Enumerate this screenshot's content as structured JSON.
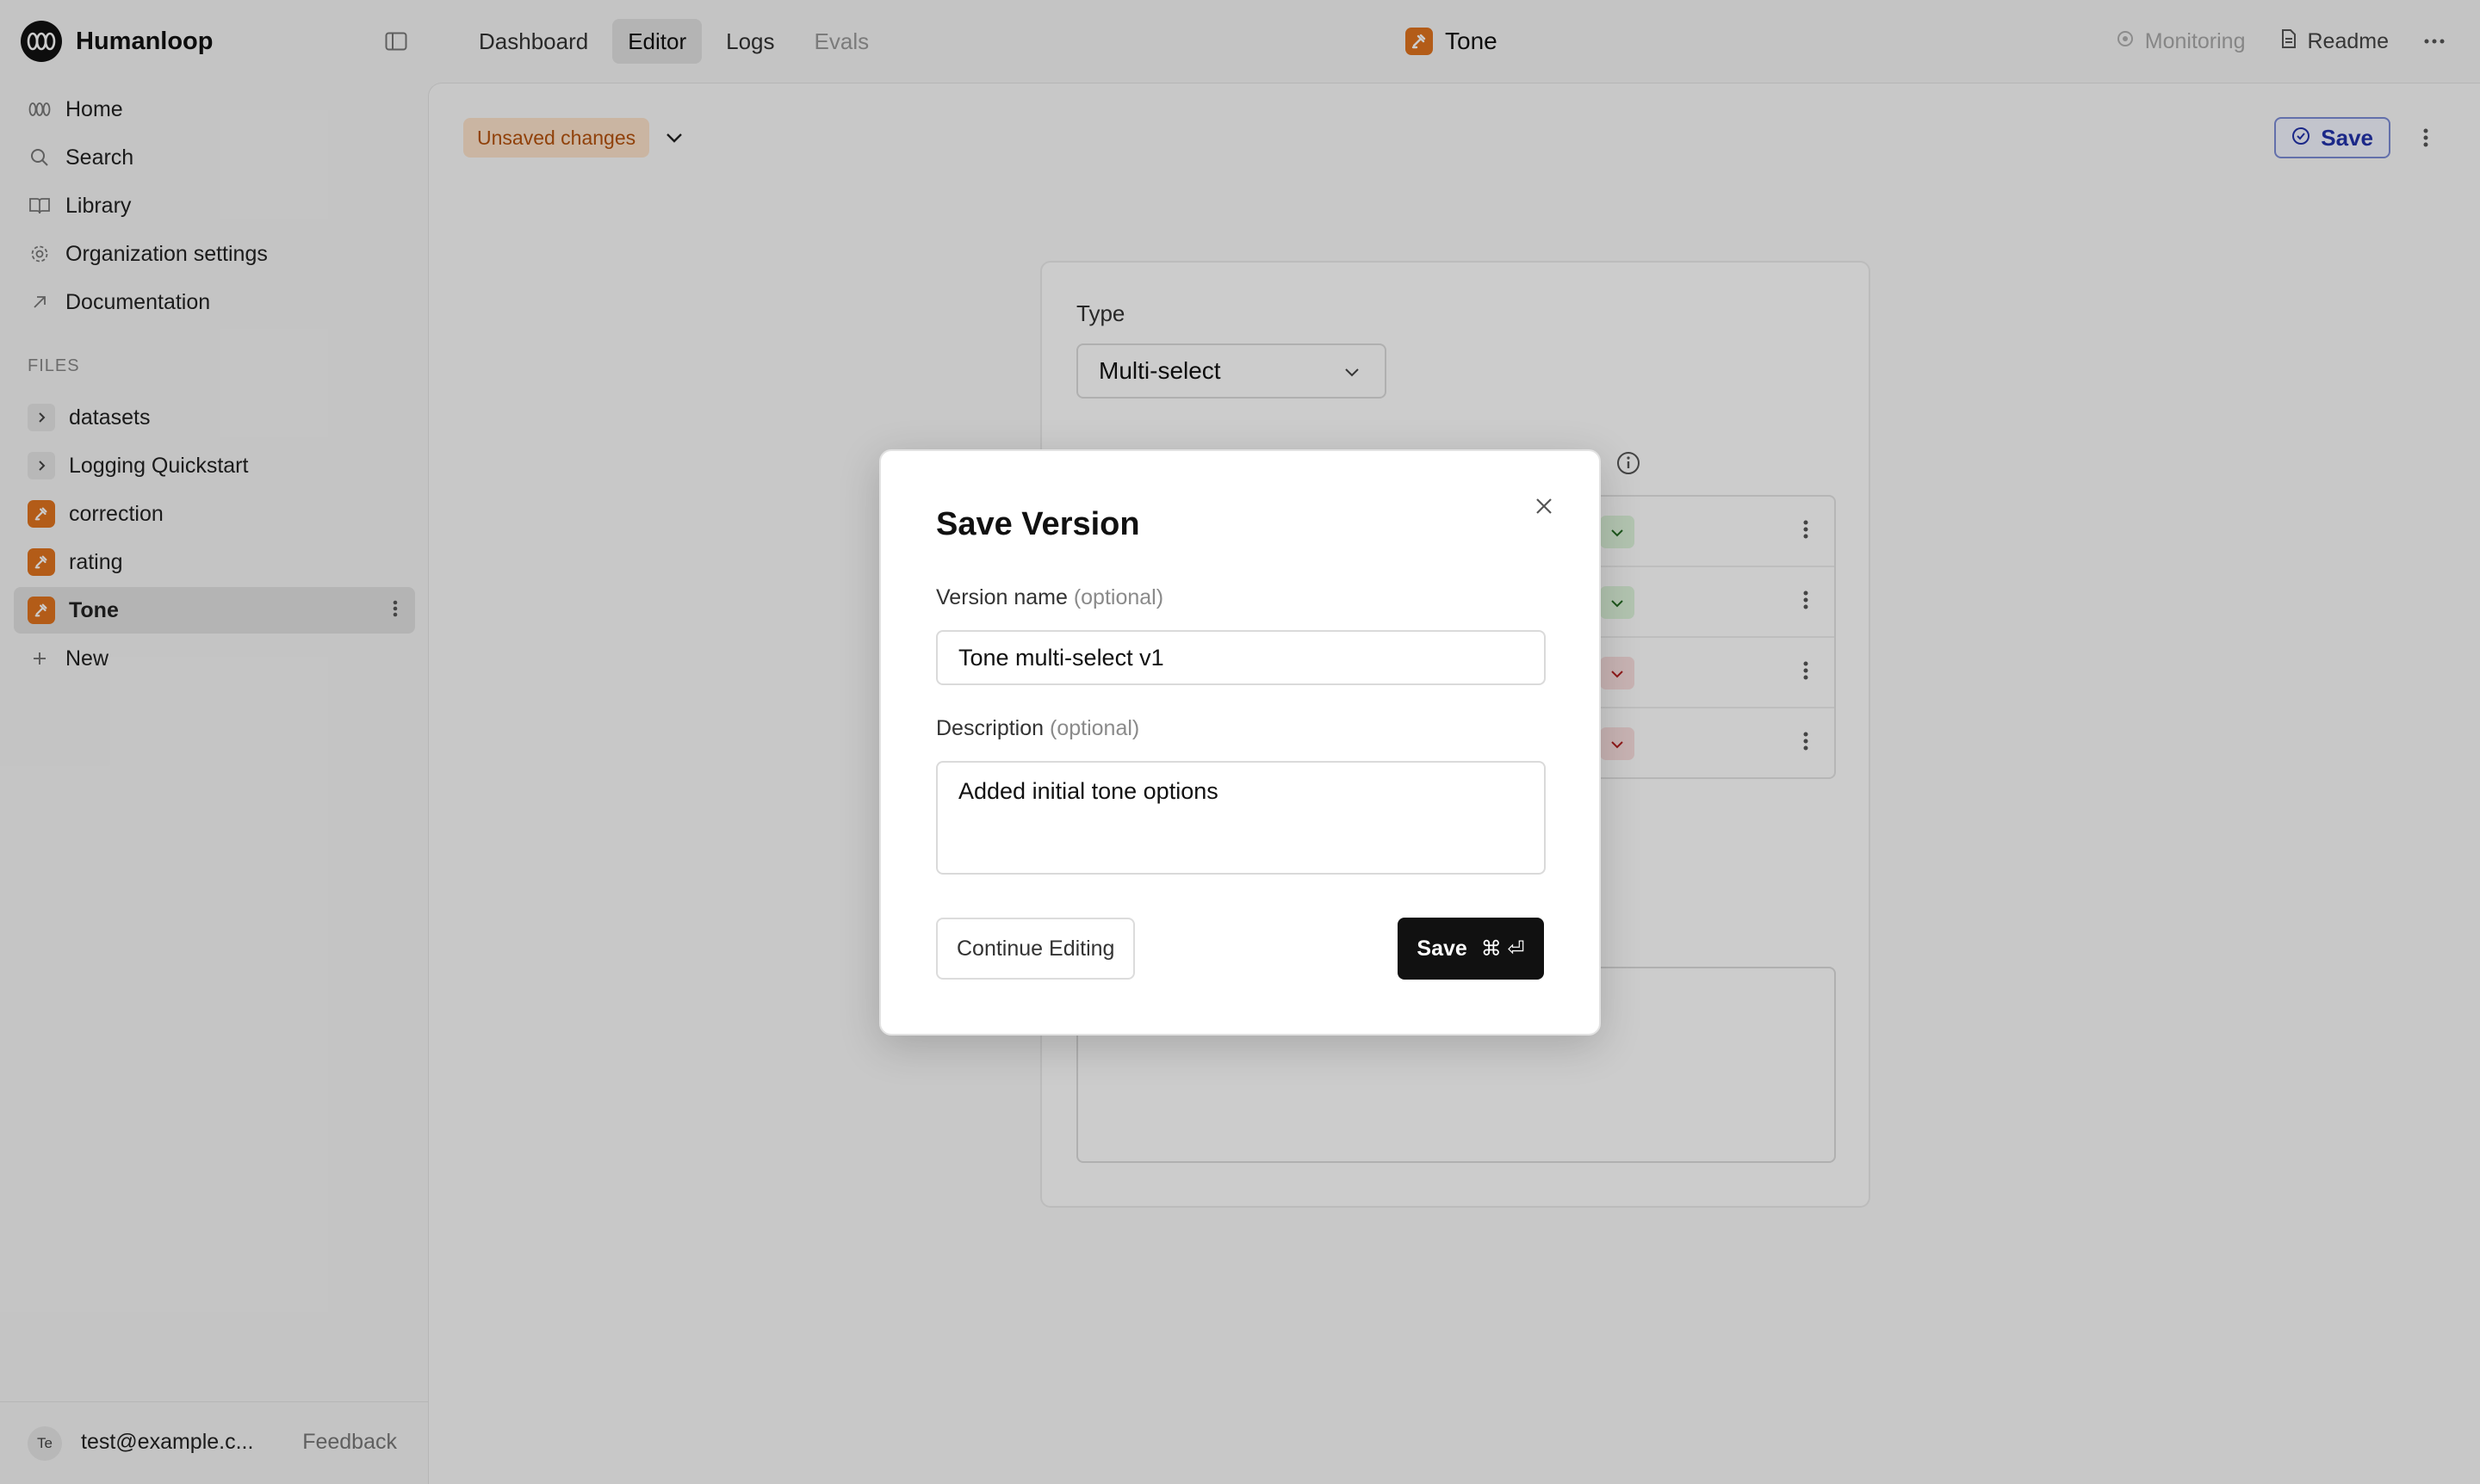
{
  "app": {
    "name": "Humanloop"
  },
  "nav": {
    "tabs": [
      "Dashboard",
      "Editor",
      "Logs",
      "Evals"
    ]
  },
  "file": {
    "title": "Tone"
  },
  "header_actions": {
    "monitoring": "Monitoring",
    "readme": "Readme"
  },
  "sidebar": {
    "items": [
      {
        "label": "Home",
        "icon": "humanloop-icon"
      },
      {
        "label": "Search",
        "icon": "search-icon"
      },
      {
        "label": "Library",
        "icon": "book-icon"
      },
      {
        "label": "Organization settings",
        "icon": "gear-icon"
      },
      {
        "label": "Documentation",
        "icon": "external-arrow-icon"
      }
    ],
    "files_label": "FILES",
    "files": [
      {
        "label": "datasets",
        "type": "folder"
      },
      {
        "label": "Logging Quickstart",
        "type": "folder"
      },
      {
        "label": "correction",
        "type": "evaluator"
      },
      {
        "label": "rating",
        "type": "evaluator"
      },
      {
        "label": "Tone",
        "type": "evaluator",
        "active": true
      }
    ],
    "new_label": "New",
    "user": {
      "initials": "Te",
      "email": "test@example.c..."
    },
    "feedback": "Feedback"
  },
  "editor": {
    "status": "Unsaved changes",
    "save_label": "Save",
    "type_label": "Type",
    "type_value": "Multi-select",
    "colors": {
      "accent_orange": "#e0731f",
      "good": "#dff5dd",
      "bad": "#fbe0e0"
    }
  },
  "modal": {
    "title": "Save Version",
    "version_label": "Version name",
    "version_optional": "(optional)",
    "version_value": "Tone multi-select v1",
    "description_label": "Description",
    "description_optional": "(optional)",
    "description_value": "Added initial tone options",
    "continue_label": "Continue Editing",
    "save_label": "Save",
    "shortcut": "⌘ ⏎"
  }
}
